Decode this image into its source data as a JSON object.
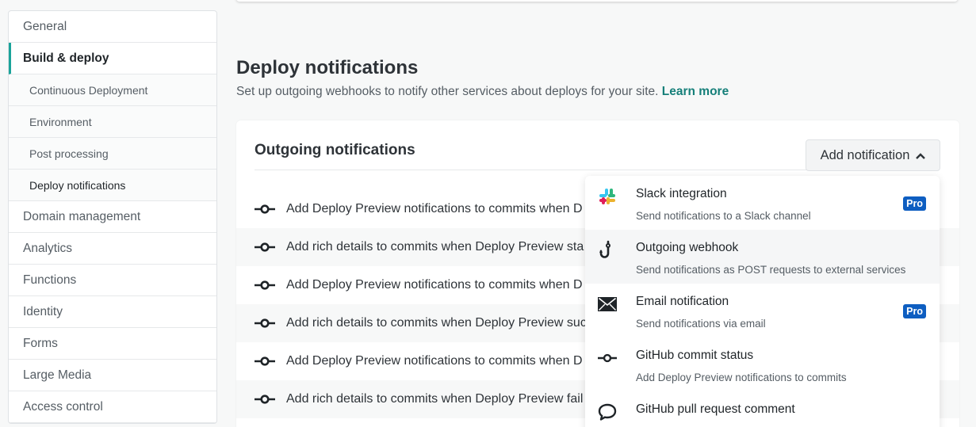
{
  "sidebar": {
    "items": [
      {
        "label": "General"
      },
      {
        "label": "Build & deploy"
      },
      {
        "label": "Continuous Deployment"
      },
      {
        "label": "Environment"
      },
      {
        "label": "Post processing"
      },
      {
        "label": "Deploy notifications"
      },
      {
        "label": "Domain management"
      },
      {
        "label": "Analytics"
      },
      {
        "label": "Functions"
      },
      {
        "label": "Identity"
      },
      {
        "label": "Forms"
      },
      {
        "label": "Large Media"
      },
      {
        "label": "Access control"
      }
    ]
  },
  "section": {
    "title": "Deploy notifications",
    "description": "Set up outgoing webhooks to notify other services about deploys for your site.",
    "learn_more": "Learn more"
  },
  "card": {
    "title": "Outgoing notifications",
    "add_button": "Add notification",
    "rows": [
      "Add Deploy Preview notifications to commits when D",
      "Add rich details to commits when Deploy Preview sta",
      "Add Deploy Preview notifications to commits when D",
      "Add rich details to commits when Deploy Preview suc",
      "Add Deploy Preview notifications to commits when D",
      "Add rich details to commits when Deploy Preview fail"
    ]
  },
  "dropdown": {
    "items": [
      {
        "title": "Slack integration",
        "subtitle": "Send notifications to a Slack channel",
        "badge": "Pro",
        "icon": "slack-icon"
      },
      {
        "title": "Outgoing webhook",
        "subtitle": "Send notifications as POST requests to external services",
        "icon": "webhook-icon"
      },
      {
        "title": "Email notification",
        "subtitle": "Send notifications via email",
        "badge": "Pro",
        "icon": "email-icon"
      },
      {
        "title": "GitHub commit status",
        "subtitle": "Add Deploy Preview notifications to commits",
        "icon": "commit-icon"
      },
      {
        "title": "GitHub pull request comment",
        "subtitle": "",
        "icon": "comment-icon"
      }
    ]
  },
  "colors": {
    "accent": "#157f79",
    "pro_badge": "#0e5ec1",
    "active_border": "#1aa39a"
  }
}
